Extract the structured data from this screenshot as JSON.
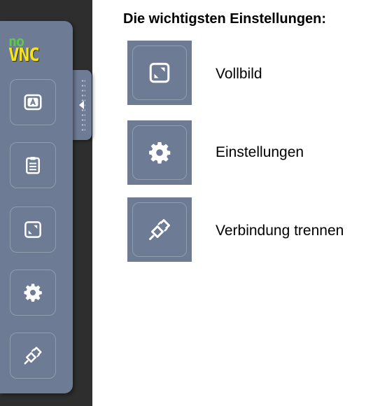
{
  "panel": {
    "logo": {
      "top": "no",
      "bottom": "VNC"
    },
    "buttons": [
      {
        "icon": "keyboard-icon"
      },
      {
        "icon": "clipboard-icon"
      },
      {
        "icon": "fullscreen-icon"
      },
      {
        "icon": "gear-icon"
      },
      {
        "icon": "disconnect-icon"
      }
    ]
  },
  "legend": {
    "title": "Die wichtigsten Einstellungen:",
    "items": [
      {
        "icon": "fullscreen-icon",
        "label": "Vollbild"
      },
      {
        "icon": "gear-icon",
        "label": "Einstellungen"
      },
      {
        "icon": "disconnect-icon",
        "label": "Verbindung trennen"
      }
    ]
  },
  "colors": {
    "panel_bg": "#6e7b95",
    "dark_bg": "#2e2e2e",
    "logo_green": "#58c94a",
    "logo_yellow": "#f7e31b"
  }
}
